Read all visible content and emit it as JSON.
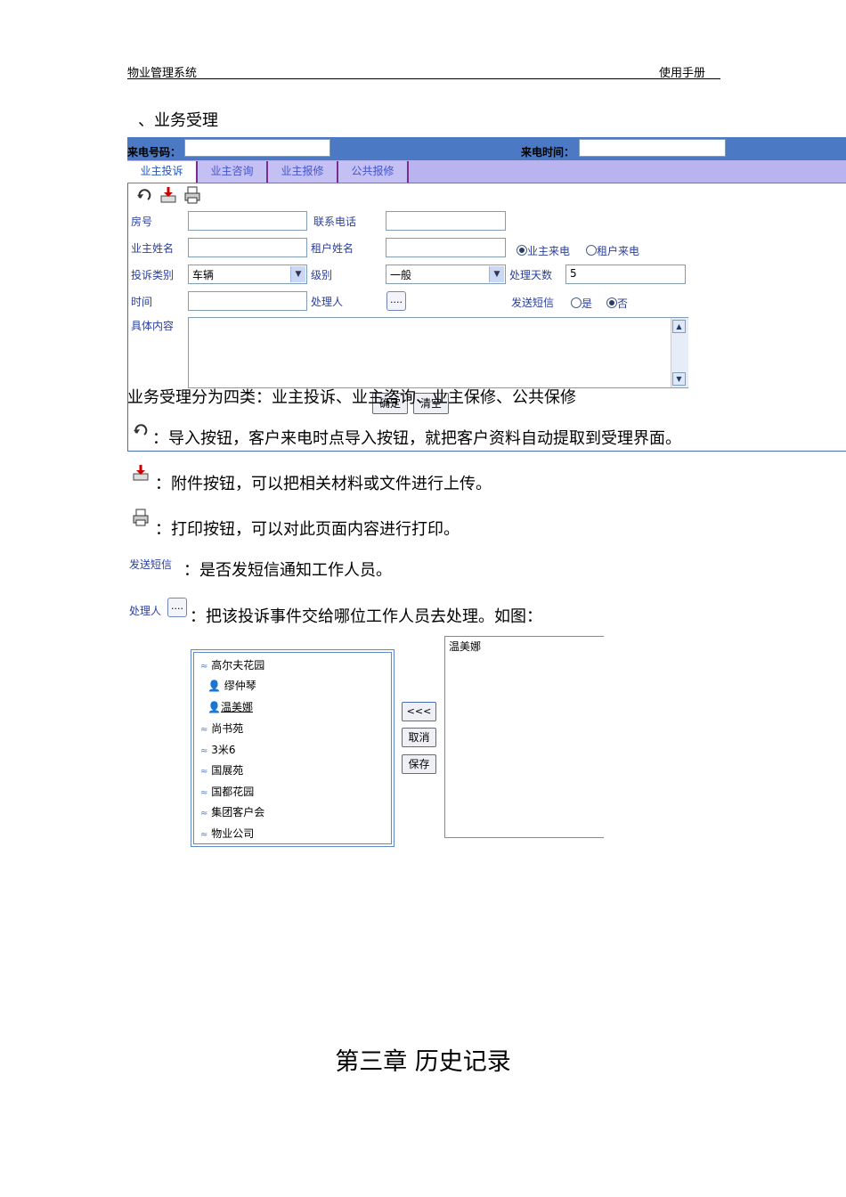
{
  "header": {
    "left": "物业管理系统",
    "right": "使用手册"
  },
  "section_title": "、业务受理",
  "form": {
    "call_number_label": "来电号码：",
    "call_time_label": "来电时间：",
    "tabs": [
      {
        "label": "业主投诉"
      },
      {
        "label": "业主咨询"
      },
      {
        "label": "业主报修"
      },
      {
        "label": "公共报修"
      }
    ],
    "room_label": "房号",
    "phone_label": "联系电话",
    "owner_name_label": "业主姓名",
    "tenant_name_label": "租户姓名",
    "radio_owner": "业主来电",
    "radio_tenant": "租户来电",
    "category_label": "投诉类别",
    "category_value": "车辆",
    "level_label": "级别",
    "level_value": "一般",
    "days_label": "处理天数",
    "days_value": "5",
    "time_label": "时间",
    "handler_label": "处理人",
    "dots": "....",
    "sms_label": "发送短信",
    "sms_yes": "是",
    "sms_no": "否",
    "content_label": "具体内容",
    "confirm": "确定",
    "clear": "清空"
  },
  "body": {
    "intro": "业务受理分为四类：业主投诉、业主咨询、业主保修、公共保修",
    "import_desc": "：导入按钮，客户来电时点导入按钮，就把客户资料自动提取到受理界面。",
    "attach_desc": "：附件按钮，可以把相关材料或文件进行上传。",
    "print_desc": "：打印按钮，可以对此页面内容进行打印。",
    "sms_label": "发送短信",
    "sms_desc": "：是否发短信通知工作人员。",
    "handler_label": "处理人",
    "handler_dots": "....",
    "handler_desc": "：把该投诉事件交给哪位工作人员去处理。如图："
  },
  "tree": {
    "nodes": [
      {
        "label": "高尔夫花园"
      },
      {
        "label": "缪仲琴"
      },
      {
        "label": "温美娜"
      },
      {
        "label": "尚书苑"
      },
      {
        "label": "3米6"
      },
      {
        "label": "国展苑"
      },
      {
        "label": "国都花园"
      },
      {
        "label": "集团客户会"
      },
      {
        "label": "物业公司"
      }
    ],
    "move_button": "<<<",
    "cancel_button": "取消",
    "save_button": "保存",
    "selected": "温美娜"
  },
  "chapter_title": "第三章  历史记录",
  "colors": {
    "topbar": "#4b79c4",
    "tabbar": "#b9b4f0",
    "label": "#2a3f9e"
  }
}
